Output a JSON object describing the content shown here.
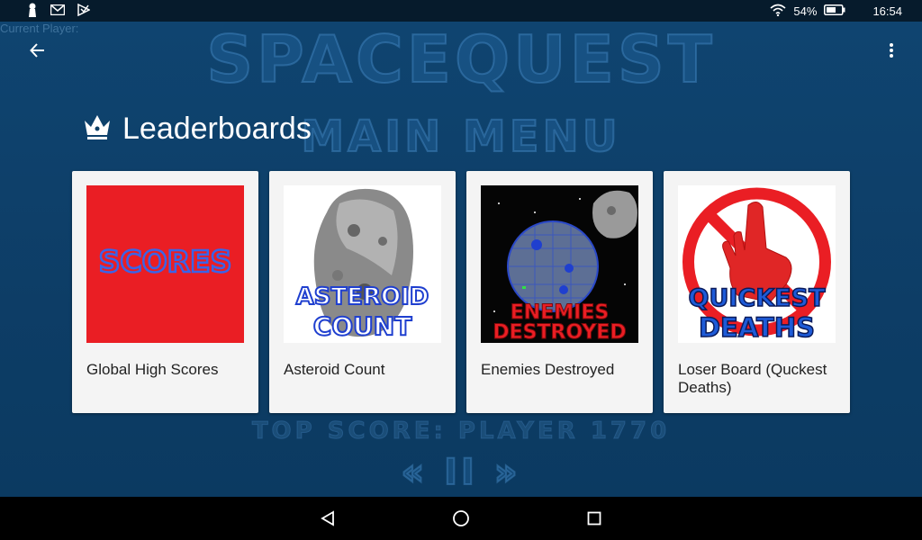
{
  "status_bar": {
    "battery": "54%",
    "time": "16:54",
    "icons": [
      "keyhole-icon",
      "gmail-icon",
      "play-games-icon",
      "wifi-icon",
      "battery-icon"
    ]
  },
  "background": {
    "current_player": "Current Player:",
    "title": "SPACEQUEST",
    "subtitle": "MAIN MENU",
    "top_score": "TOP SCORE: PLAYER 1770",
    "controls": "« II »"
  },
  "app_bar": {
    "back_icon": "arrow-back-icon",
    "menu_icon": "more-vert-icon"
  },
  "page": {
    "title": "Leaderboards",
    "title_icon": "crown-icon"
  },
  "leaderboards": [
    {
      "label": "Global High Scores",
      "image_text": "SCORES"
    },
    {
      "label": "Asteroid Count",
      "image_text_1": "ASTEROID",
      "image_text_2": "COUNT"
    },
    {
      "label": "Enemies Destroyed",
      "image_text_1": "ENEMIES",
      "image_text_2": "DESTROYED"
    },
    {
      "label": "Loser Board (Quckest Deaths)",
      "image_text_1": "QUICKEST",
      "image_text_2": "DEATHS"
    }
  ],
  "colors": {
    "background": "#0d3f66",
    "card": "#f4f4f4",
    "scores_red": "#ea1e24",
    "logo_text_blue": "#1f3fcf"
  }
}
